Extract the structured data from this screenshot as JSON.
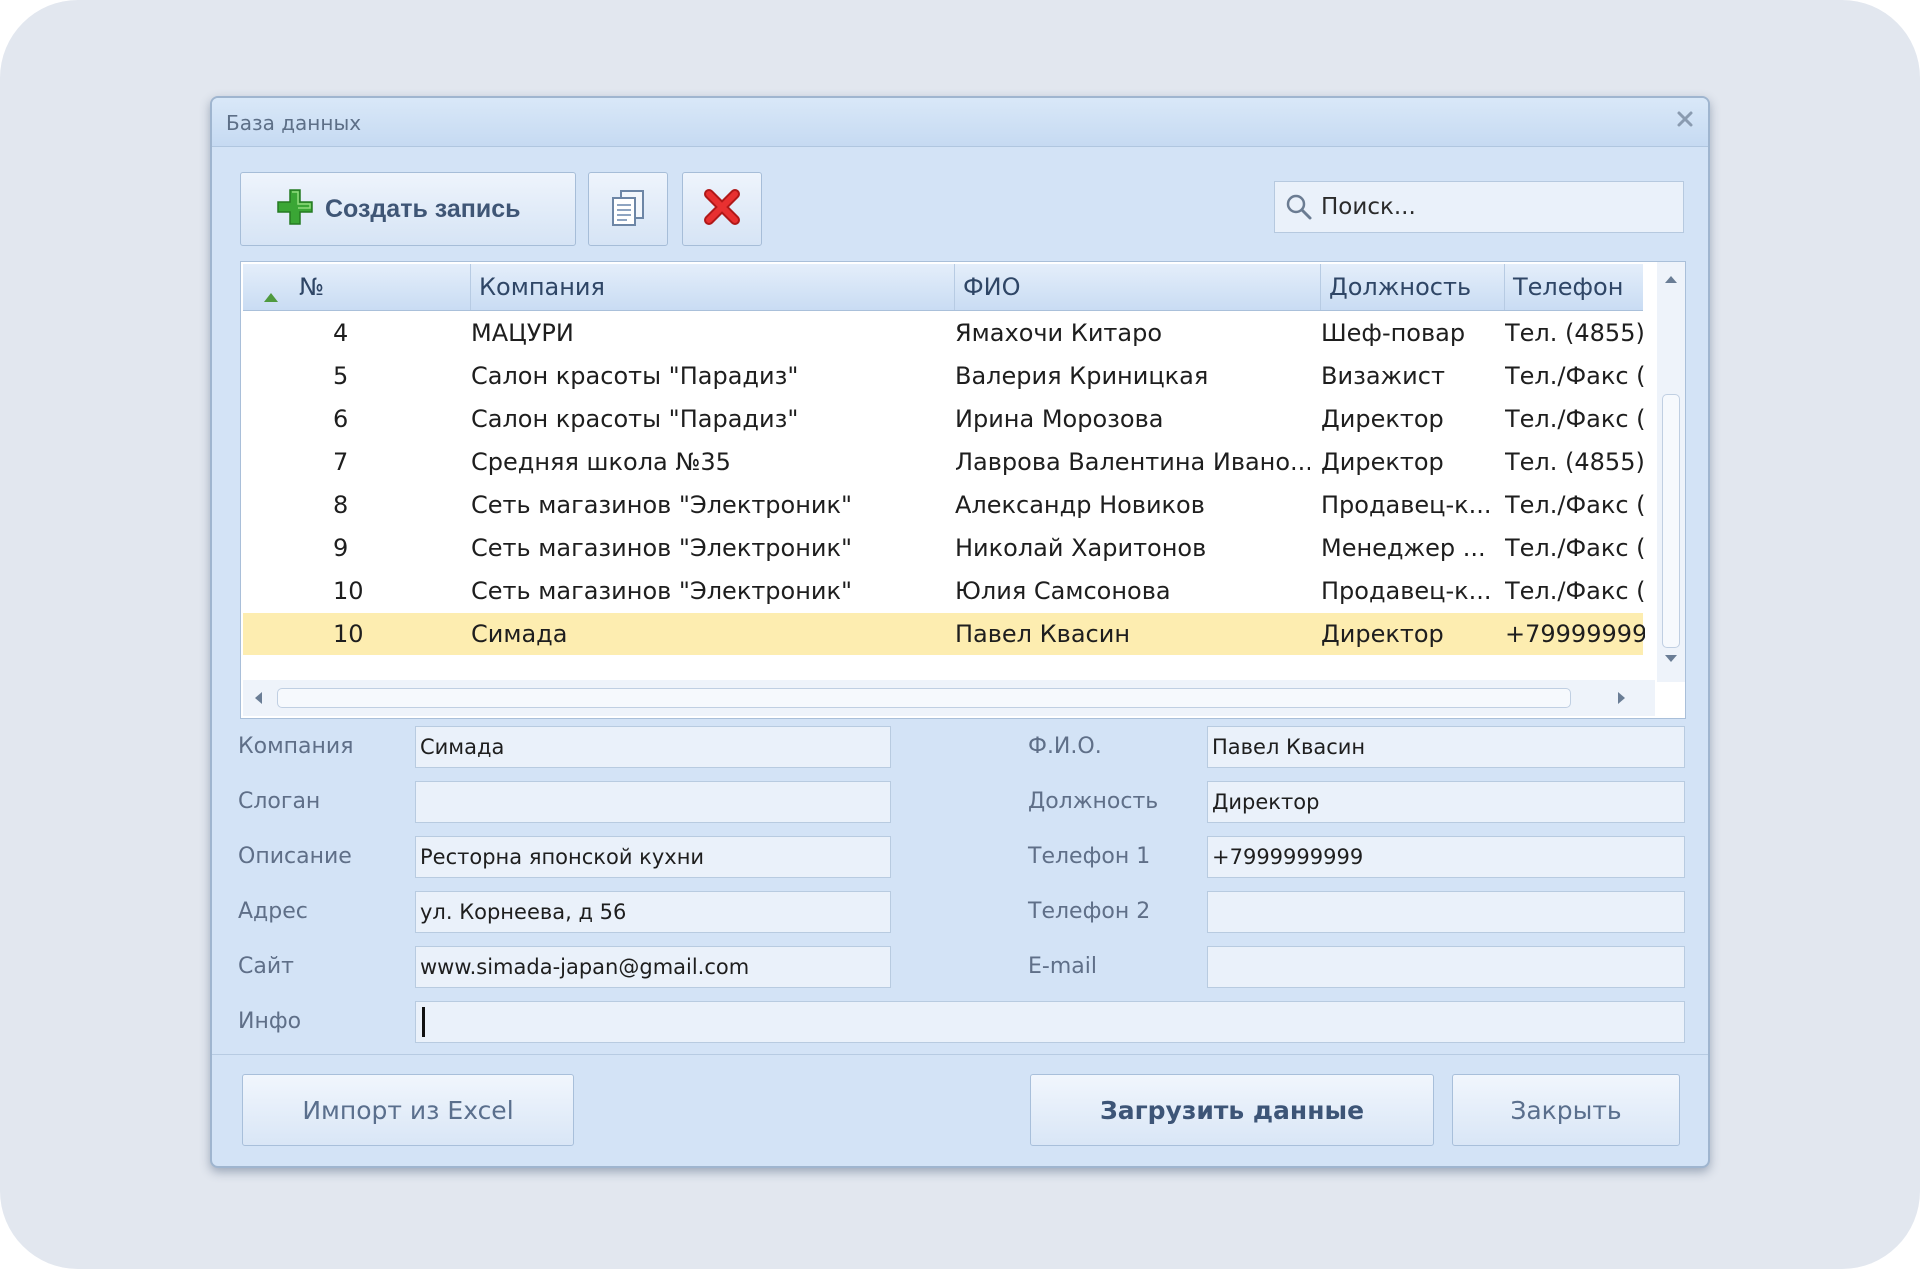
{
  "window": {
    "title": "База данных"
  },
  "toolbar": {
    "create_label": "Создать запись",
    "search_placeholder": "Поиск..."
  },
  "grid": {
    "columns": [
      "№",
      "Компания",
      "ФИО",
      "Должность",
      "Телефон"
    ],
    "rows": [
      {
        "num": "4",
        "company": "МАЦУРИ",
        "fio": "Ямахочи Китаро",
        "position": "Шеф-повар",
        "phone": "Тел. (4855)",
        "selected": false
      },
      {
        "num": "5",
        "company": "Салон красоты \"Парадиз\"",
        "fio": "Валерия Криницкая",
        "position": "Визажист",
        "phone": "Тел./Факс (",
        "selected": false
      },
      {
        "num": "6",
        "company": "Салон красоты \"Парадиз\"",
        "fio": "Ирина Морозова",
        "position": "Директор",
        "phone": "Тел./Факс (",
        "selected": false
      },
      {
        "num": "7",
        "company": "Средняя школа №35",
        "fio": "Лаврова Валентина Ивано...",
        "position": "Директор",
        "phone": "Тел. (4855)",
        "selected": false
      },
      {
        "num": "8",
        "company": "Сеть магазинов \"Электроник\"",
        "fio": "Александр Новиков",
        "position": "Продавец-к...",
        "phone": "Тел./Факс (",
        "selected": false
      },
      {
        "num": "9",
        "company": "Сеть магазинов \"Электроник\"",
        "fio": "Николай Харитонов",
        "position": "Менеджер ...",
        "phone": "Тел./Факс (",
        "selected": false
      },
      {
        "num": "10",
        "company": "Сеть магазинов \"Электроник\"",
        "fio": "Юлия Самсонова",
        "position": "Продавец-к...",
        "phone": "Тел./Факс (",
        "selected": false
      },
      {
        "num": "10",
        "company": "Симада",
        "fio": "Павел Квасин",
        "position": "Директор",
        "phone": "+79999999",
        "selected": true
      }
    ]
  },
  "form": {
    "company_label": "Компания",
    "company_value": "Симада",
    "slogan_label": "Слоган",
    "slogan_value": "",
    "description_label": "Описание",
    "description_value": "Ресторна японской кухни",
    "address_label": "Адрес",
    "address_value": "ул. Корнеева, д 56",
    "site_label": "Сайт",
    "site_value": "www.simada-japan@gmail.com",
    "info_label": "Инфо",
    "info_value": "",
    "fio_label": "Ф.И.О.",
    "fio_value": "Павел Квасин",
    "position_label": "Должность",
    "position_value": "Директор",
    "phone1_label": "Телефон 1",
    "phone1_value": "+7999999999",
    "phone2_label": "Телефон 2",
    "phone2_value": "",
    "email_label": "E-mail",
    "email_value": ""
  },
  "footer": {
    "import_label": "Импорт из Excel",
    "load_label": "Загрузить данные",
    "close_label": "Закрыть"
  },
  "colors": {
    "selected_row": "#fdedb0",
    "create_icon": "#3aa635",
    "delete_icon": "#d42020"
  }
}
